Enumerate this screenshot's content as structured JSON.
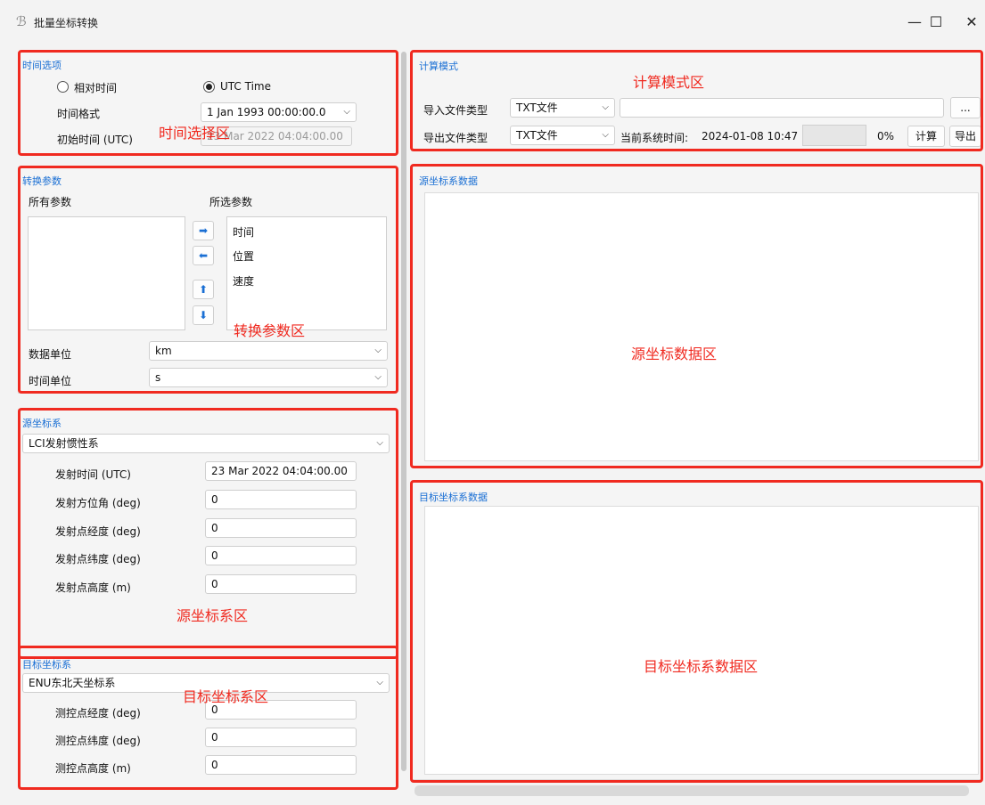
{
  "window": {
    "title": "批量坐标转换",
    "app_icon": "app-logo-icon",
    "minimize_glyph": "—",
    "maximize_glyph": "☐",
    "close_glyph": "✕"
  },
  "time_options": {
    "title": "时间选项",
    "radio_relative": "相对时间",
    "radio_utc": "UTC Time",
    "selected": "UTC Time",
    "format_label": "时间格式",
    "format_value": "1 Jan 1993 00:00:00.0",
    "initial_time_label": "初始时间 (UTC)",
    "initial_time_value": "23 Mar 2022 04:04:00.00"
  },
  "conversion_params": {
    "title": "转换参数",
    "all_params_label": "所有参数",
    "selected_params_label": "所选参数",
    "all_params": [],
    "selected_params": [
      "时间",
      "位置",
      "速度"
    ],
    "data_unit_label": "数据单位",
    "data_unit_value": "km",
    "time_unit_label": "时间单位",
    "time_unit_value": "s"
  },
  "source_frame": {
    "title": "源坐标系",
    "frame_value": "LCI发射惯性系",
    "fields": [
      {
        "label": "发射时间 (UTC)",
        "value": "23 Mar 2022 04:04:00.00"
      },
      {
        "label": "发射方位角 (deg)",
        "value": "0"
      },
      {
        "label": "发射点经度 (deg)",
        "value": "0"
      },
      {
        "label": "发射点纬度 (deg)",
        "value": "0"
      },
      {
        "label": "发射点高度 (m)",
        "value": "0"
      }
    ]
  },
  "target_frame": {
    "title": "目标坐标系",
    "frame_value": "ENU东北天坐标系",
    "fields": [
      {
        "label": "测控点经度 (deg)",
        "value": "0"
      },
      {
        "label": "测控点纬度 (deg)",
        "value": "0"
      },
      {
        "label": "测控点高度 (m)",
        "value": "0"
      }
    ]
  },
  "compute_mode": {
    "title": "计算模式",
    "import_label": "导入文件类型",
    "import_type": "TXT文件",
    "import_path": "",
    "browse_label": "...",
    "export_label": "导出文件类型",
    "export_type": "TXT文件",
    "system_time_label": "当前系统时间:",
    "system_time_value": "2024-01-08 10:47",
    "progress_percent": 0,
    "progress_text": "0%",
    "compute_button": "计算",
    "export_button": "导出"
  },
  "source_data": {
    "title": "源坐标系数据"
  },
  "target_data": {
    "title": "目标坐标系数据"
  },
  "annotations": {
    "time_select": "时间选择区",
    "conversion_params": "转换参数区",
    "source_frame": "源坐标系区",
    "target_frame": "目标坐标系区",
    "compute_mode": "计算模式区",
    "source_data": "源坐标数据区",
    "target_data": "目标坐标系数据区"
  },
  "colors": {
    "annotation_red": "#f02a20",
    "section_title_blue": "#1a6fd4"
  }
}
